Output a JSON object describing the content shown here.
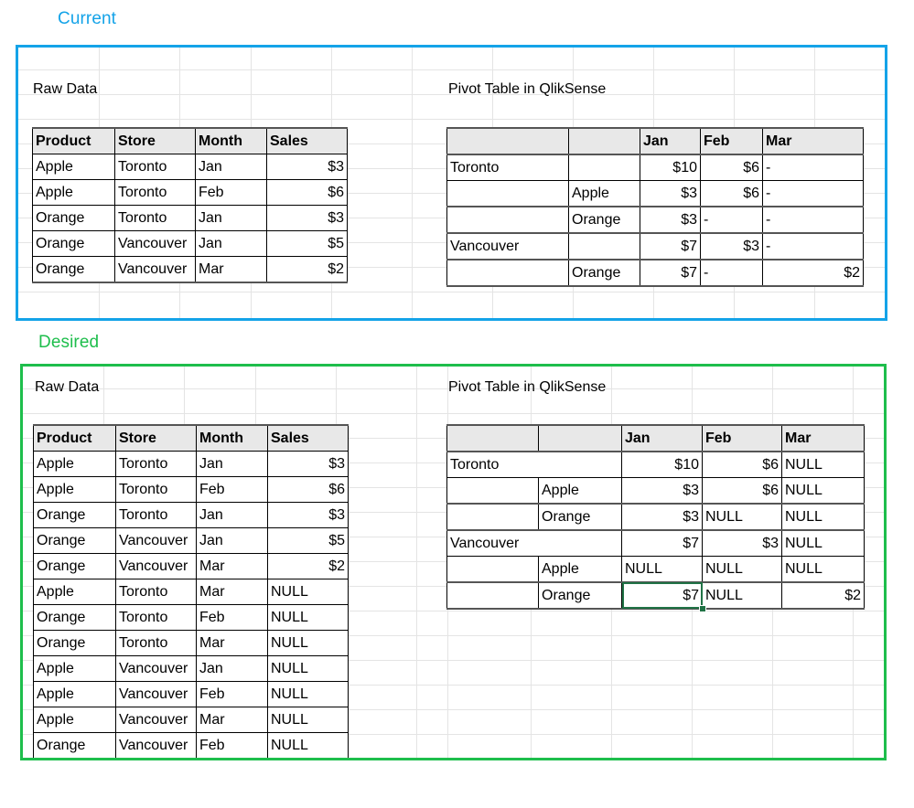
{
  "sections": {
    "current": {
      "label": "Current",
      "accent_color": "#14A3E8",
      "raw_caption": "Raw Data",
      "pivot_caption": "Pivot Table in QlikSense"
    },
    "desired": {
      "label": "Desired",
      "accent_color": "#1EBE4C",
      "raw_caption": "Raw Data",
      "pivot_caption": "Pivot Table in QlikSense"
    }
  },
  "raw_table": {
    "headers": [
      "Product",
      "Store",
      "Month",
      "Sales"
    ],
    "current_rows": [
      [
        "Apple",
        "Toronto",
        "Jan",
        "$3"
      ],
      [
        "Apple",
        "Toronto",
        "Feb",
        "$6"
      ],
      [
        "Orange",
        "Toronto",
        "Jan",
        "$3"
      ],
      [
        "Orange",
        "Vancouver",
        "Jan",
        "$5"
      ],
      [
        "Orange",
        "Vancouver",
        "Mar",
        "$2"
      ]
    ],
    "desired_rows": [
      [
        "Apple",
        "Toronto",
        "Jan",
        "$3"
      ],
      [
        "Apple",
        "Toronto",
        "Feb",
        "$6"
      ],
      [
        "Orange",
        "Toronto",
        "Jan",
        "$3"
      ],
      [
        "Orange",
        "Vancouver",
        "Jan",
        "$5"
      ],
      [
        "Orange",
        "Vancouver",
        "Mar",
        "$2"
      ],
      [
        "Apple",
        "Toronto",
        "Mar",
        "NULL"
      ],
      [
        "Orange",
        "Toronto",
        "Feb",
        "NULL"
      ],
      [
        "Orange",
        "Toronto",
        "Mar",
        "NULL"
      ],
      [
        "Apple",
        "Vancouver",
        "Jan",
        "NULL"
      ],
      [
        "Apple",
        "Vancouver",
        "Feb",
        "NULL"
      ],
      [
        "Apple",
        "Vancouver",
        "Mar",
        "NULL"
      ],
      [
        "Orange",
        "Vancouver",
        "Feb",
        "NULL"
      ]
    ]
  },
  "pivot_current": {
    "headers": [
      "",
      "",
      "Jan",
      "Feb",
      "Mar"
    ],
    "rows": [
      {
        "store": "Toronto",
        "product": "",
        "jan": "$10",
        "feb": "$6",
        "mar": "-",
        "bold": true,
        "group": true
      },
      {
        "store": "",
        "product": "Apple",
        "jan": "$3",
        "feb": "$6",
        "mar": "-",
        "bold": false,
        "group": false
      },
      {
        "store": "",
        "product": "Orange",
        "jan": "$3",
        "feb": "-",
        "mar": "-",
        "bold": false,
        "group": true
      },
      {
        "store": "Vancouver",
        "product": "",
        "jan": "$7",
        "feb": "$3",
        "mar": "-",
        "bold": true,
        "group": true
      },
      {
        "store": "",
        "product": "Orange",
        "jan": "$7",
        "feb": "-",
        "mar": "$2",
        "bold": false,
        "group": true
      }
    ]
  },
  "pivot_desired": {
    "headers": [
      "",
      "",
      "Jan",
      "Feb",
      "Mar"
    ],
    "rows": [
      {
        "store": "Toronto",
        "product": "",
        "jan": "$10",
        "feb": "$6",
        "mar": "NULL",
        "bold": true,
        "group": true
      },
      {
        "store": "",
        "product": "Apple",
        "jan": "$3",
        "feb": "$6",
        "mar": "NULL",
        "bold": false,
        "group": false
      },
      {
        "store": "",
        "product": "Orange",
        "jan": "$3",
        "feb": "NULL",
        "mar": "NULL",
        "bold": false,
        "group": true
      },
      {
        "store": "Vancouver",
        "product": "",
        "jan": "$7",
        "feb": "$3",
        "mar": "NULL",
        "bold": true,
        "group": true
      },
      {
        "store": "",
        "product": "Apple",
        "jan": "NULL",
        "feb": "NULL",
        "mar": "NULL",
        "bold": false,
        "group": false
      },
      {
        "store": "",
        "product": "Orange",
        "jan": "$7",
        "feb": "NULL",
        "mar": "$2",
        "bold": false,
        "group": true
      }
    ],
    "selected_cell": {
      "row": 5,
      "column": "jan",
      "value": "$7"
    }
  },
  "colors": {
    "current_accent": "#14A3E8",
    "desired_accent": "#1EBE4C",
    "selection_green": "#217346",
    "header_fill": "#E8E8E8",
    "gridline": "#E4E4E4",
    "border": "#000000"
  }
}
